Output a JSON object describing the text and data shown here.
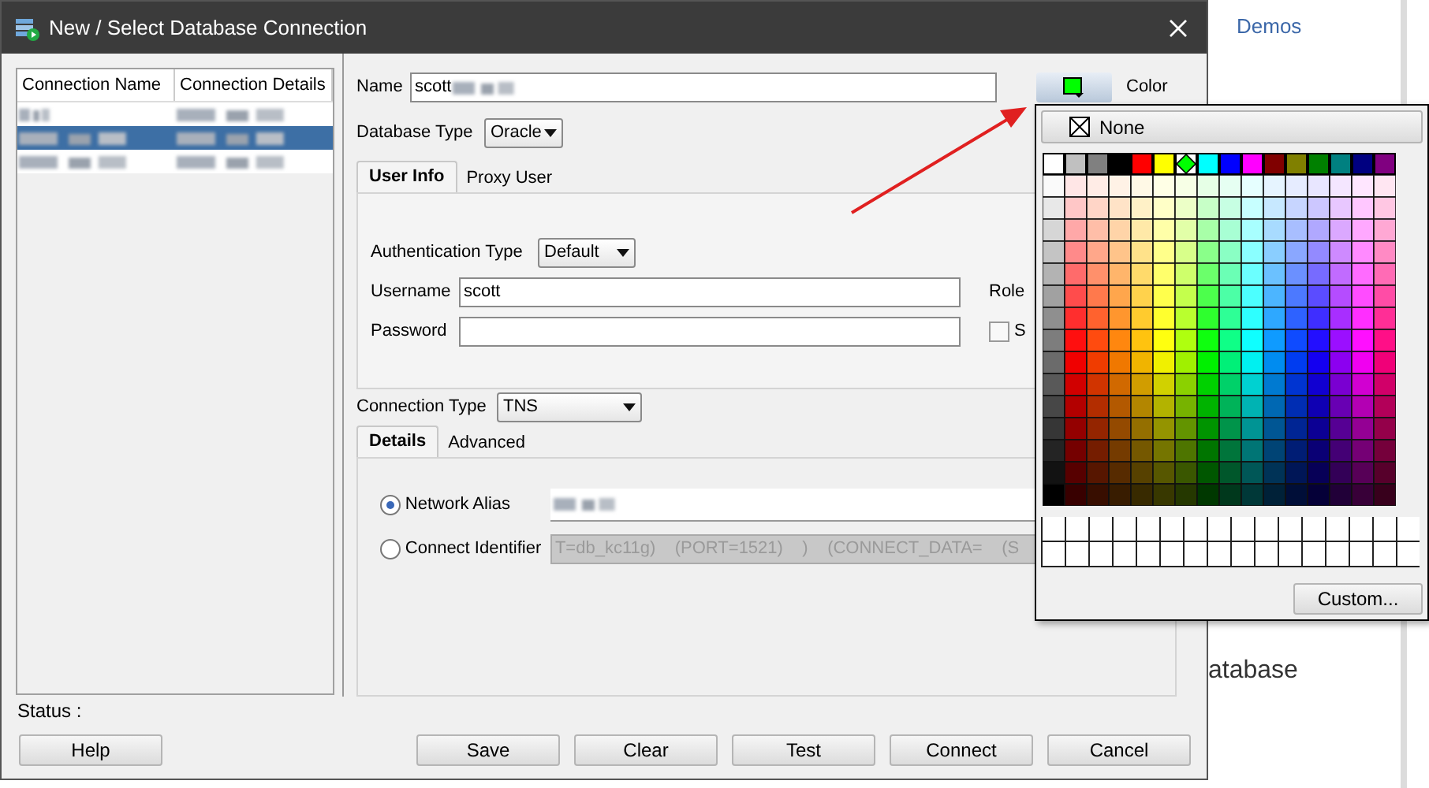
{
  "background": {
    "link": "Demos",
    "heading": "atabase"
  },
  "window": {
    "title": "New / Select Database Connection"
  },
  "connections": {
    "columns": [
      "Connection Name",
      "Connection Details"
    ],
    "rows": [
      {
        "selected": false
      },
      {
        "selected": true
      },
      {
        "selected": false
      }
    ]
  },
  "form": {
    "name_label": "Name",
    "name_value": "scott",
    "color_label": "Color",
    "color": "#00ff00",
    "database_type_label": "Database Type",
    "database_type": "Oracle",
    "tabs": [
      {
        "label": "User Info",
        "selected": true
      },
      {
        "label": "Proxy User",
        "selected": false
      }
    ],
    "auth_type_label": "Authentication Type",
    "auth_type": "Default",
    "username_label": "Username",
    "username": "scott",
    "password_label": "Password",
    "role_label": "Role",
    "checkbox": {
      "label": "S",
      "checked": false
    },
    "connection_type_label": "Connection Type",
    "connection_type": "TNS",
    "detail_tabs": [
      {
        "label": "Details",
        "selected": true
      },
      {
        "label": "Advanced",
        "selected": false
      }
    ],
    "options": [
      {
        "label": "Network Alias",
        "selected": true
      },
      {
        "label": "Connect Identifier",
        "selected": false,
        "value": "T=db_kc11g)    (PORT=1521)    )    (CONNECT_DATA=    (S"
      }
    ]
  },
  "status_label": "Status :",
  "buttons": [
    "Help",
    "Save",
    "Clear",
    "Test",
    "Connect",
    "Cancel"
  ],
  "color_popup": {
    "none_label": "None",
    "custom_label": "Custom...",
    "swatches": [
      {
        "color": "#ffffff",
        "selected": false
      },
      {
        "color": "#c0c0c0",
        "selected": false
      },
      {
        "color": "#808080",
        "selected": false
      },
      {
        "color": "#000000",
        "selected": false
      },
      {
        "color": "#ff0000",
        "selected": false
      },
      {
        "color": "#ffff00",
        "selected": false
      },
      {
        "color": "#00ff00",
        "selected": true
      },
      {
        "color": "#00ffff",
        "selected": false
      },
      {
        "color": "#0000ff",
        "selected": false
      },
      {
        "color": "#ff00ff",
        "selected": false
      },
      {
        "color": "#800000",
        "selected": false
      },
      {
        "color": "#808000",
        "selected": false
      },
      {
        "color": "#008000",
        "selected": false
      },
      {
        "color": "#008080",
        "selected": false
      },
      {
        "color": "#000080",
        "selected": false
      },
      {
        "color": "#800080",
        "selected": false
      }
    ]
  }
}
